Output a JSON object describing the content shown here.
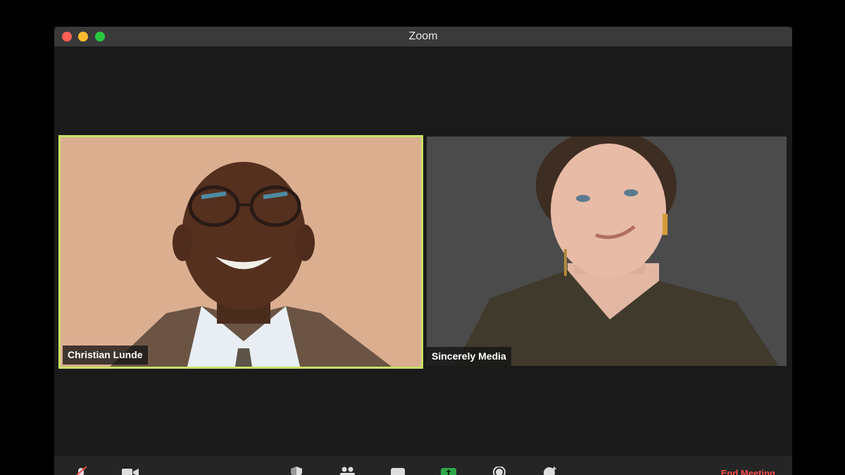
{
  "window": {
    "title": "Zoom"
  },
  "participants": [
    {
      "name": "Christian Lunde",
      "active_speaker": true
    },
    {
      "name": "Sincerely Media",
      "active_speaker": false
    }
  ],
  "toolbar": {
    "end_label": "End Meeting",
    "icons": [
      "microphone-muted-icon",
      "video-icon",
      "security-icon",
      "participants-icon",
      "chat-icon",
      "share-screen-icon",
      "record-icon",
      "reactions-icon"
    ]
  },
  "colors": {
    "active_border": "#c9e265",
    "end_meeting": "#ff4d4d",
    "share_green": "#2ea84a"
  }
}
